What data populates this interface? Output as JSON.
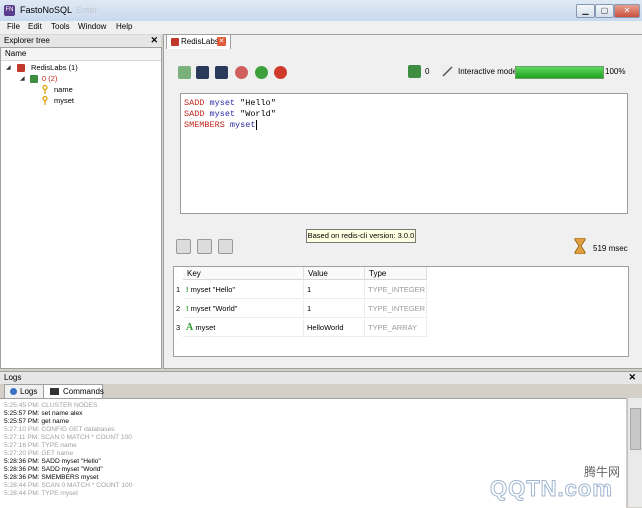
{
  "window": {
    "title": "FastoNoSQL",
    "title_suffix": "Enter",
    "min_label": "▁",
    "max_label": "▢",
    "close_label": "✕"
  },
  "menu": [
    "File",
    "Edit",
    "Tools",
    "Window",
    "Help"
  ],
  "explorer": {
    "title": "Explorer tree",
    "close": "✕",
    "column": "Name",
    "server": "RedisLabs (1)",
    "database": "0 (2)",
    "keys": [
      "name",
      "myset"
    ]
  },
  "tab": {
    "label": "RedisLabs",
    "close": "✕"
  },
  "toolbar": {
    "key_count": "0",
    "mode_label": "Interactive mode",
    "progress_text": "100%",
    "progress_value": 100
  },
  "editor": {
    "lines": [
      {
        "cmd": "SADD",
        "key": "myset",
        "arg": " \"Hello\""
      },
      {
        "cmd": "SADD",
        "key": "myset",
        "arg": " \"World\""
      },
      {
        "cmd": "SMEMBERS",
        "key": "myset",
        "arg": ""
      }
    ]
  },
  "tooltip": "Based on redis-cli version: 3.0.0",
  "exec_time": "519 msec",
  "results": {
    "headers": [
      "Key",
      "Value",
      "Type"
    ],
    "rows": [
      {
        "num": "1",
        "key": "myset \"Hello\"",
        "value": "1",
        "type": "TYPE_INTEGER"
      },
      {
        "num": "2",
        "key": "myset \"World\"",
        "value": "1",
        "type": "TYPE_INTEGER"
      },
      {
        "num": "3",
        "key": "myset",
        "value": "HelloWorld",
        "type": "TYPE_ARRAY"
      }
    ]
  },
  "logs": {
    "title": "Logs",
    "close": "✕",
    "tabs": [
      "Logs",
      "Commands"
    ],
    "lines": [
      {
        "text": "5:25:45 PM: CLUSTER NODES",
        "dim": true
      },
      {
        "text": "5:25:57 PM: set name alex",
        "dim": false
      },
      {
        "text": "5:25:57 PM: get name",
        "dim": false
      },
      {
        "text": "5:27:10 PM: CONFIG GET databases",
        "dim": true
      },
      {
        "text": "5:27:11 PM: SCAN 0 MATCH * COUNT 100",
        "dim": true
      },
      {
        "text": "5:27:16 PM: TYPE name",
        "dim": true
      },
      {
        "text": "5:27:20 PM: GET name",
        "dim": true
      },
      {
        "text": "5:28:36 PM: SADD myset \"Hello\"",
        "dim": false
      },
      {
        "text": "5:28:36 PM: SADD myset \"World\"",
        "dim": false
      },
      {
        "text": "5:28:36 PM: SMEMBERS myset",
        "dim": false
      },
      {
        "text": "5:28:44 PM: SCAN 0 MATCH * COUNT 100",
        "dim": true
      },
      {
        "text": "5:28:44 PM: TYPE myset",
        "dim": true
      }
    ]
  },
  "watermark": {
    "top": "腾牛网",
    "bottom": "QQTN.com"
  }
}
